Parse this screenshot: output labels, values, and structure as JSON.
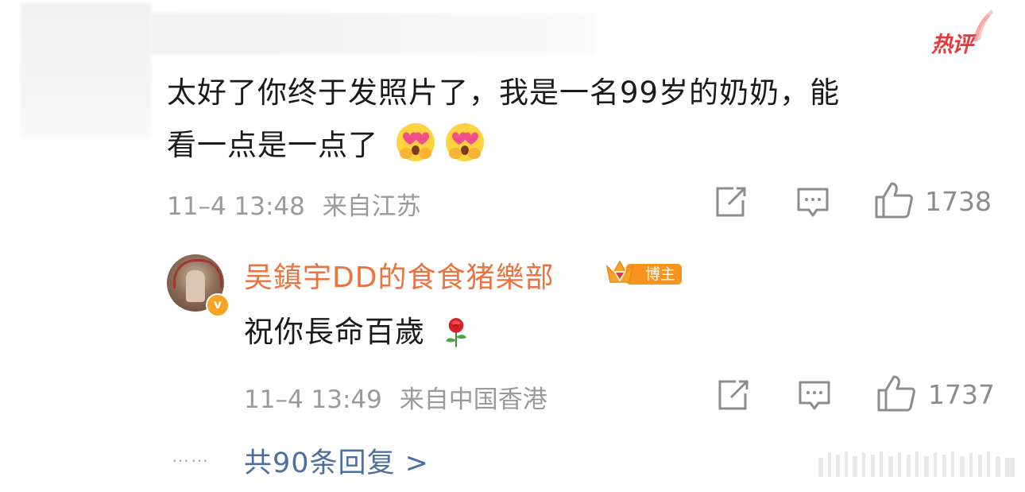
{
  "hot_badge": {
    "label": "热评"
  },
  "main_comment": {
    "text_line1": "太好了你终于发照片了，我是一名99岁的奶奶，能",
    "text_line2": "看一点是一点了",
    "emojis": [
      "heart-eyes-emoji",
      "heart-eyes-emoji"
    ],
    "time": "11–4 13:48",
    "location": "来自江苏",
    "like_count": "1738"
  },
  "reply": {
    "author": "吴鎮宇DD的食食猪樂部",
    "badge_label": "博主",
    "verified_icon": "v-badge-icon",
    "text": "祝你長命百歲",
    "emoji": "rose-emoji",
    "time": "11–4 13:49",
    "location": "来自中国香港",
    "like_count": "1737"
  },
  "more_replies": {
    "dots": "……",
    "label": "共90条回复 >"
  },
  "colors": {
    "accent_author": "#eb7340",
    "link": "#4a6fa0",
    "meta": "#9a9a9a",
    "hot": "#e4393c",
    "badge": "#f7931e"
  }
}
